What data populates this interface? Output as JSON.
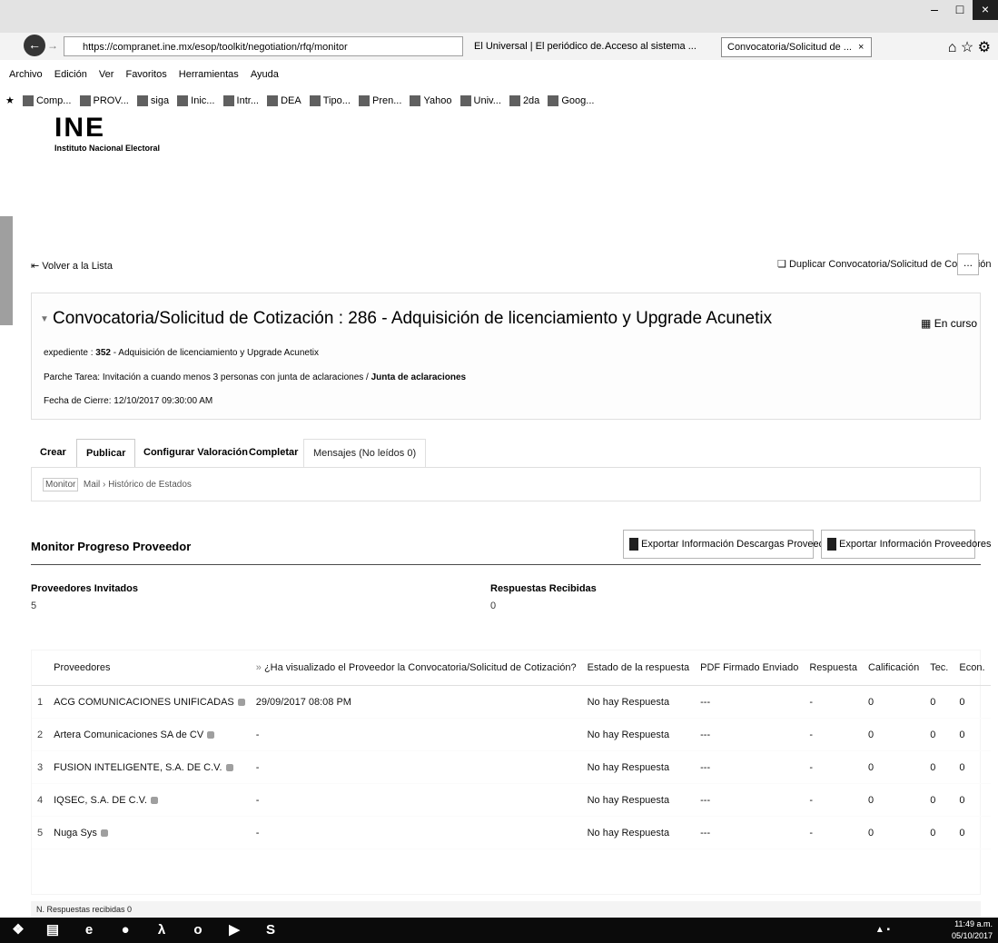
{
  "browser": {
    "url": "https://compranet.ine.mx/esop/toolkit/negotiation/rfq/monitor",
    "tabs": [
      "El Universal | El periódico de...",
      "Acceso al sistema ...",
      "Convocatoria/Solicitud de ..."
    ],
    "tab_close": "×",
    "win_buttons": [
      "–",
      "□",
      "×"
    ]
  },
  "menubar": [
    "Archivo",
    "Edición",
    "Ver",
    "Favoritos",
    "Herramientas",
    "Ayuda"
  ],
  "favorites": [
    "Comp...",
    "PROV...",
    "siga",
    "Inic...",
    "Intr...",
    "DEA",
    "Tipo...",
    "Pren...",
    "Yahoo",
    "Univ...",
    "2da",
    "Goog..."
  ],
  "logo": {
    "mark": "INE",
    "subtitle": "Instituto Nacional Electoral"
  },
  "page": {
    "back_link": "Volver a la Lista",
    "duplicate_link": "Duplicar Convocatoria/Solicitud de Cotización",
    "more_button": "...",
    "title": "Convocatoria/Solicitud de Cotización : 286 - Adquisición de licenciamiento y Upgrade Acunetix",
    "status": "En curso",
    "expediente_label": "expediente :",
    "expediente_num": "352",
    "expediente_desc": "- Adquisición de licenciamiento y Upgrade Acunetix",
    "fase_text": "Parche Tarea: Invitación a cuando menos 3 personas con junta de aclaraciones /",
    "fase_bold": "Junta de aclaraciones",
    "fecha_cierre": "Fecha de Cierre: 12/10/2017 09:30:00 AM"
  },
  "tabs": [
    "Crear",
    "Publicar",
    "Configurar Valoración",
    "Completar",
    "Mensajes (No leídos 0)"
  ],
  "subnav": {
    "monitor": "Monitor",
    "mail": "Mail",
    "separator": "›",
    "historico": "Histórico de Estados"
  },
  "monitor": {
    "title": "Monitor Progreso Proveedor",
    "export_downloads": "Exportar Información Descargas Proveedores",
    "export_info": "Exportar Información Proveedores",
    "invited_label": "Proveedores Invitados",
    "invited_value": "5",
    "responses_label": "Respuestas Recibidas",
    "responses_value": "0"
  },
  "table": {
    "headers": [
      "",
      "Proveedores",
      "¿Ha visualizado el Proveedor la Convocatoria/Solicitud de Cotización?",
      "Estado de la respuesta",
      "PDF Firmado Enviado",
      "Respuesta",
      "Calificación",
      "Tec.",
      "Econ."
    ],
    "rows": [
      [
        "1",
        "ACG COMUNICACIONES UNIFICADAS",
        "29/09/2017 08:08 PM",
        "No hay Respuesta",
        "---",
        "-",
        "0",
        "0",
        "0"
      ],
      [
        "2",
        "Artera Comunicaciones SA de CV",
        "-",
        "No hay Respuesta",
        "---",
        "-",
        "0",
        "0",
        "0"
      ],
      [
        "3",
        "FUSION INTELIGENTE, S.A. DE C.V.",
        "-",
        "No hay Respuesta",
        "---",
        "-",
        "0",
        "0",
        "0"
      ],
      [
        "4",
        "IQSEC, S.A. DE C.V.",
        "-",
        "No hay Respuesta",
        "---",
        "-",
        "0",
        "0",
        "0"
      ],
      [
        "5",
        "Nuga Sys",
        "-",
        "No hay Respuesta",
        "---",
        "-",
        "0",
        "0",
        "0"
      ]
    ]
  },
  "footer": "N. Respuestas recibidas 0",
  "taskbar": {
    "icons": [
      "windows-start",
      "file-explorer",
      "internet-explorer",
      "app-circle",
      "acrobat",
      "outlook",
      "media",
      "skype"
    ],
    "time": "11:49 a.m.",
    "date": "05/10/2017"
  }
}
